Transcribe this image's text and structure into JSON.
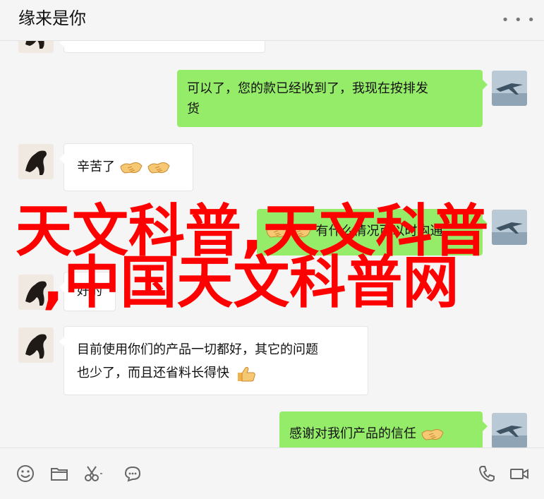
{
  "header": {
    "title": "缘来是你",
    "more_icon": "more-icon"
  },
  "messages": [
    {
      "side": "in",
      "text": ""
    },
    {
      "side": "out",
      "text_line1": "可以了，您的款已经收到了，我现在按排发",
      "text_line2": "货"
    },
    {
      "side": "in",
      "text": "辛苦了",
      "emoji": "handshake-icon"
    },
    {
      "side": "out",
      "text": "有什么情况可以时沟通",
      "emoji": "handshake-icon"
    },
    {
      "side": "in",
      "text": "好的"
    },
    {
      "side": "in",
      "text_line1": "目前使用你们的产品一切都好，其它的问题",
      "text_line2": "也少了，而且还省料长得快",
      "emoji": "thumbs-up-icon"
    },
    {
      "side": "out",
      "text": "感谢对我们产品的信任",
      "emoji": "handshake-icon"
    }
  ],
  "watermark": {
    "line1": "天文科普,天文科普",
    "line2": ",中国天文科普网",
    "color": "#ff0000"
  },
  "toolbar": {
    "left_icons": [
      "emoji-icon",
      "folder-icon",
      "scissors-icon",
      "chat-bubble-icon"
    ],
    "right_icons": [
      "phone-icon",
      "video-icon"
    ]
  },
  "colors": {
    "outgoing_bubble": "#95ec69",
    "incoming_bubble": "#ffffff",
    "background": "#f5f5f5"
  }
}
